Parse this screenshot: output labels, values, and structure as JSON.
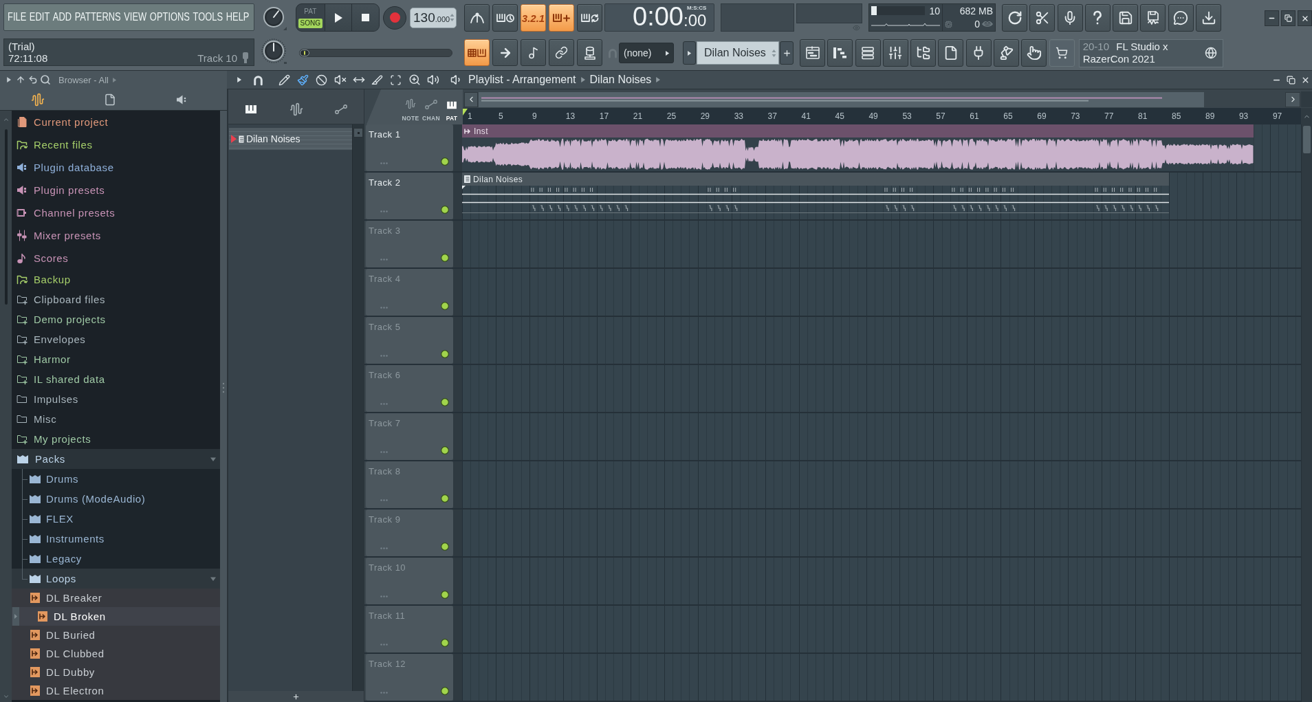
{
  "main_menu": [
    "FILE",
    "EDIT",
    "ADD",
    "PATTERNS",
    "VIEW",
    "OPTIONS",
    "TOOLS",
    "HELP"
  ],
  "hint_bar": {
    "status": "(Trial)",
    "time": "72:11:08",
    "track": "Track 10"
  },
  "transport": {
    "modes": [
      {
        "label": "PAT",
        "selected": false
      },
      {
        "label": "SONG",
        "selected": true
      }
    ],
    "tempo": "130",
    "tempo_fraction": ".000"
  },
  "song_position": {
    "level": 0
  },
  "record_options": [
    {
      "on": false
    },
    {
      "on": false
    },
    {
      "label": "3.2.1",
      "on": true
    },
    {
      "on": true
    },
    {
      "on": false
    }
  ],
  "input_options": [
    {
      "on": true
    },
    {
      "on": false
    },
    {
      "on": false
    },
    {
      "on": false
    },
    {
      "on": false
    }
  ],
  "time_display": {
    "value": "0:00",
    "centiseconds": ":00",
    "format": "M:S:CS"
  },
  "performance": {
    "cpu_meter": {
      "level": 0.1
    },
    "polyphony": "10",
    "memory": "682 MB",
    "reading": "0"
  },
  "snap": {
    "value": "(none)"
  },
  "pattern_selector": {
    "pattern": "Dilan Noises"
  },
  "news": {
    "date": "20-10",
    "headline": "FL Studio x RazerCon 2021"
  },
  "browser": {
    "title": "Browser - All",
    "tabs": [
      {
        "selected": true
      },
      {
        "selected": false
      },
      {
        "selected": false
      }
    ],
    "items": [
      {
        "name": "Current project",
        "kind": "project",
        "color": "#e0987a",
        "selected": false,
        "expanded": false
      },
      {
        "name": "Recent files",
        "kind": "recent",
        "color": "#a6cf6a",
        "selected": false,
        "expanded": false
      },
      {
        "name": "Plugin database",
        "kind": "plugin",
        "color": "#8fb0da",
        "selected": false,
        "expanded": false
      },
      {
        "name": "Plugin presets",
        "kind": "plugin",
        "color": "#c893b6",
        "selected": false,
        "expanded": false
      },
      {
        "name": "Channel presets",
        "kind": "channel",
        "color": "#c893b6",
        "selected": false,
        "expanded": false
      },
      {
        "name": "Mixer presets",
        "kind": "mixer",
        "color": "#c893b6",
        "selected": false,
        "expanded": false
      },
      {
        "name": "Scores",
        "kind": "score",
        "color": "#c893b6",
        "selected": false,
        "expanded": false
      },
      {
        "name": "Backup",
        "kind": "recent",
        "color": "#a6cf6a",
        "selected": false,
        "expanded": false
      },
      {
        "name": "Clipboard files",
        "kind": "linked",
        "color": "#a9b6bd",
        "selected": false,
        "expanded": false
      },
      {
        "name": "Demo projects",
        "kind": "linked",
        "color": "#9fc9a5",
        "selected": false,
        "expanded": false
      },
      {
        "name": "Envelopes",
        "kind": "linked",
        "color": "#a9b6bd",
        "selected": false,
        "expanded": false
      },
      {
        "name": "Harmor",
        "kind": "linked",
        "color": "#9fc9a5",
        "selected": false,
        "expanded": false
      },
      {
        "name": "IL shared data",
        "kind": "linked",
        "color": "#9fc9a5",
        "selected": false,
        "expanded": false
      },
      {
        "name": "Impulses",
        "kind": "folder",
        "color": "#a9b6bd",
        "selected": false,
        "expanded": false
      },
      {
        "name": "Misc",
        "kind": "folder",
        "color": "#a9b6bd",
        "selected": false,
        "expanded": false
      },
      {
        "name": "My projects",
        "kind": "linked",
        "color": "#9fc9a5",
        "selected": false,
        "expanded": false
      },
      {
        "name": "Packs",
        "kind": "pack",
        "color": "#bcd3e8",
        "selected": false,
        "expanded": true,
        "children": [
          {
            "name": "Drums",
            "kind": "pack",
            "color": "#9ab6d3",
            "selected": false,
            "expanded": false
          },
          {
            "name": "Drums (ModeAudio)",
            "kind": "pack",
            "color": "#9ab6d3",
            "selected": false,
            "expanded": false
          },
          {
            "name": "FLEX",
            "kind": "pack",
            "color": "#9ab6d3",
            "selected": false,
            "expanded": false
          },
          {
            "name": "Instruments",
            "kind": "pack",
            "color": "#9ab6d3",
            "selected": false,
            "expanded": false
          },
          {
            "name": "Legacy",
            "kind": "pack",
            "color": "#9ab6d3",
            "selected": false,
            "expanded": false
          },
          {
            "name": "Loops",
            "kind": "pack",
            "color": "#bcd3e8",
            "selected": false,
            "expanded": true,
            "children": [
              {
                "name": "DL Breaker",
                "kind": "loop",
                "selected": false
              },
              {
                "name": "DL Broken",
                "kind": "loop",
                "selected": true
              },
              {
                "name": "DL Buried",
                "kind": "loop",
                "selected": false
              },
              {
                "name": "DL Clubbed",
                "kind": "loop",
                "selected": false
              },
              {
                "name": "DL Dubby",
                "kind": "loop",
                "selected": false
              },
              {
                "name": "DL Electron",
                "kind": "loop",
                "selected": false
              }
            ]
          }
        ]
      }
    ]
  },
  "playlist": {
    "tools": [
      {
        "selected": false
      },
      {
        "selected": true
      },
      {
        "selected": false
      },
      {
        "selected": false
      },
      {
        "selected": false
      },
      {
        "selected": false
      },
      {
        "selected": false
      },
      {
        "selected": false
      },
      {
        "selected": false
      }
    ],
    "breadcrumb": [
      "Playlist - Arrangement",
      "Dilan Noises"
    ],
    "picker_tabs": [
      {
        "selected": true
      },
      {
        "selected": false
      },
      {
        "selected": false
      }
    ],
    "patterns": [
      {
        "name": "Dilan Noises",
        "selected": true
      }
    ],
    "view_modes": [
      {
        "label": "NOTE",
        "selected": false
      },
      {
        "label": "CHAN",
        "selected": false
      },
      {
        "label": "PAT",
        "selected": true
      }
    ],
    "ruler": [
      "1",
      "5",
      "9",
      "13",
      "17",
      "21",
      "25",
      "29",
      "33",
      "37",
      "41",
      "45",
      "49",
      "53",
      "57",
      "61",
      "65",
      "69",
      "73",
      "77",
      "81",
      "85",
      "89",
      "93",
      "97"
    ],
    "tracks": [
      {
        "name": "Track 1",
        "enabled": true,
        "clips": [
          {
            "name": "Inst",
            "kind": "audio"
          }
        ]
      },
      {
        "name": "Track 2",
        "enabled": true,
        "clips": [
          {
            "name": "Dilan Noises",
            "kind": "pattern"
          }
        ]
      },
      {
        "name": "Track 3",
        "enabled": true
      },
      {
        "name": "Track 4",
        "enabled": true
      },
      {
        "name": "Track 5",
        "enabled": true
      },
      {
        "name": "Track 6",
        "enabled": true
      },
      {
        "name": "Track 7",
        "enabled": true
      },
      {
        "name": "Track 8",
        "enabled": true
      },
      {
        "name": "Track 9",
        "enabled": true
      },
      {
        "name": "Track 10",
        "enabled": true
      },
      {
        "name": "Track 11",
        "enabled": true
      },
      {
        "name": "Track 12",
        "enabled": true
      }
    ]
  }
}
